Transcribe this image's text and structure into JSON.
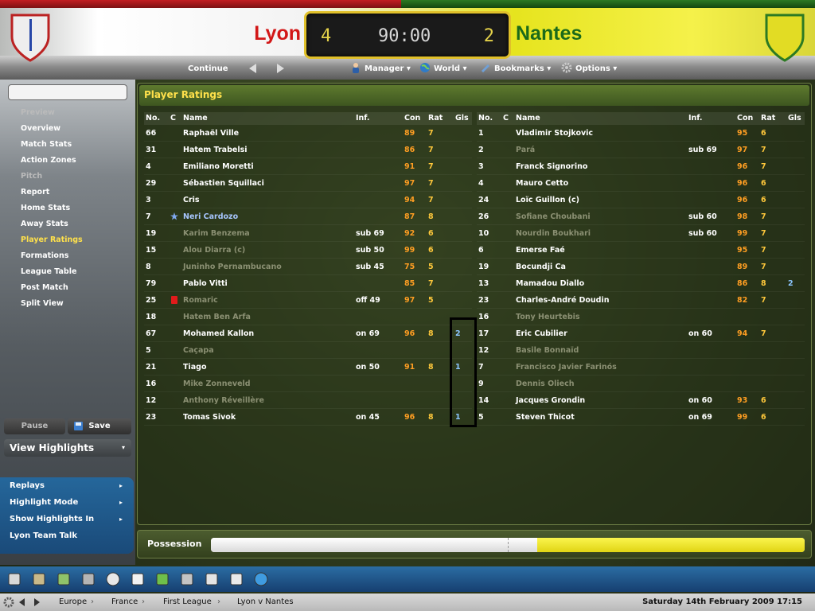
{
  "match": {
    "home_team": "Lyon",
    "away_team": "Nantes",
    "home_score": "4",
    "away_score": "2",
    "clock": "90:00",
    "home_color": "#d21717",
    "away_color": "#1b6a1a"
  },
  "toolbar": {
    "continue_label": "Continue",
    "manager_label": "Manager",
    "world_label": "World",
    "bookmarks_label": "Bookmarks",
    "options_label": "Options"
  },
  "sidebar": {
    "search_placeholder": "",
    "items": [
      {
        "label": "Preview",
        "kind": "section"
      },
      {
        "label": "Overview",
        "kind": "link"
      },
      {
        "label": "Match Stats",
        "kind": "link"
      },
      {
        "label": "Action Zones",
        "kind": "link"
      },
      {
        "label": "Pitch",
        "kind": "section"
      },
      {
        "label": "Report",
        "kind": "link"
      },
      {
        "label": "Home Stats",
        "kind": "link"
      },
      {
        "label": "Away Stats",
        "kind": "link"
      },
      {
        "label": "Player Ratings",
        "kind": "active"
      },
      {
        "label": "Formations",
        "kind": "link"
      },
      {
        "label": "League Table",
        "kind": "link"
      },
      {
        "label": "Post Match",
        "kind": "link"
      },
      {
        "label": "Split View",
        "kind": "link"
      }
    ],
    "pause_label": "Pause",
    "save_label": "Save",
    "view_highlights_label": "View Highlights",
    "highlight_items": [
      "Replays",
      "Highlight Mode",
      "Show Highlights In",
      "Lyon Team Talk"
    ]
  },
  "ratings": {
    "title": "Player Ratings",
    "headers": {
      "no": "No.",
      "c": "C",
      "name": "Name",
      "inf": "Inf.",
      "con": "Con",
      "rat": "Rat",
      "gls": "Gls"
    },
    "home": [
      {
        "no": "66",
        "name": "Raphaël Ville",
        "inf": "",
        "con": "89",
        "rat": "7",
        "gls": "",
        "dim": false,
        "icon": ""
      },
      {
        "no": "31",
        "name": "Hatem Trabelsi",
        "inf": "",
        "con": "86",
        "rat": "7",
        "gls": "",
        "dim": false,
        "icon": ""
      },
      {
        "no": "4",
        "name": "Emiliano Moretti",
        "inf": "",
        "con": "91",
        "rat": "7",
        "gls": "",
        "dim": false,
        "icon": ""
      },
      {
        "no": "29",
        "name": "Sébastien Squillaci",
        "inf": "",
        "con": "97",
        "rat": "7",
        "gls": "",
        "dim": false,
        "icon": ""
      },
      {
        "no": "3",
        "name": "Cris",
        "inf": "",
        "con": "94",
        "rat": "7",
        "gls": "",
        "dim": false,
        "icon": ""
      },
      {
        "no": "7",
        "name": "Neri Cardozo",
        "inf": "",
        "con": "87",
        "rat": "8",
        "gls": "",
        "dim": false,
        "icon": "star-icon"
      },
      {
        "no": "19",
        "name": "Karim Benzema",
        "inf": "sub 69",
        "con": "92",
        "rat": "6",
        "gls": "",
        "dim": true,
        "icon": ""
      },
      {
        "no": "15",
        "name": "Alou Diarra (c)",
        "inf": "sub 50",
        "con": "99",
        "rat": "6",
        "gls": "",
        "dim": true,
        "icon": ""
      },
      {
        "no": "8",
        "name": "Juninho Pernambucano",
        "inf": "sub 45",
        "con": "75",
        "rat": "5",
        "gls": "",
        "dim": true,
        "icon": ""
      },
      {
        "no": "79",
        "name": "Pablo Vitti",
        "inf": "",
        "con": "85",
        "rat": "7",
        "gls": "",
        "dim": false,
        "icon": ""
      },
      {
        "no": "25",
        "name": "Romaric",
        "inf": "off 49",
        "con": "97",
        "rat": "5",
        "gls": "",
        "dim": true,
        "icon": "red-card-icon"
      },
      {
        "no": "18",
        "name": "Hatem Ben Arfa",
        "inf": "",
        "con": "",
        "rat": "",
        "gls": "",
        "dim": true,
        "icon": ""
      },
      {
        "no": "67",
        "name": "Mohamed Kallon",
        "inf": "on 69",
        "con": "96",
        "rat": "8",
        "gls": "2",
        "dim": false,
        "icon": ""
      },
      {
        "no": "5",
        "name": "Caçapa",
        "inf": "",
        "con": "",
        "rat": "",
        "gls": "",
        "dim": true,
        "icon": ""
      },
      {
        "no": "21",
        "name": "Tiago",
        "inf": "on 50",
        "con": "91",
        "rat": "8",
        "gls": "1",
        "dim": false,
        "icon": ""
      },
      {
        "no": "16",
        "name": "Mike Zonneveld",
        "inf": "",
        "con": "",
        "rat": "",
        "gls": "",
        "dim": true,
        "icon": ""
      },
      {
        "no": "12",
        "name": "Anthony Réveillère",
        "inf": "",
        "con": "",
        "rat": "",
        "gls": "",
        "dim": true,
        "icon": ""
      },
      {
        "no": "23",
        "name": "Tomas Sivok",
        "inf": "on 45",
        "con": "96",
        "rat": "8",
        "gls": "1",
        "dim": false,
        "icon": ""
      }
    ],
    "away": [
      {
        "no": "1",
        "name": "Vladimir Stojkovic",
        "inf": "",
        "con": "95",
        "rat": "6",
        "gls": "",
        "dim": false,
        "icon": ""
      },
      {
        "no": "2",
        "name": "Pará",
        "inf": "sub 69",
        "con": "97",
        "rat": "7",
        "gls": "",
        "dim": true,
        "icon": ""
      },
      {
        "no": "3",
        "name": "Franck Signorino",
        "inf": "",
        "con": "96",
        "rat": "7",
        "gls": "",
        "dim": false,
        "icon": ""
      },
      {
        "no": "4",
        "name": "Mauro Cetto",
        "inf": "",
        "con": "96",
        "rat": "6",
        "gls": "",
        "dim": false,
        "icon": ""
      },
      {
        "no": "24",
        "name": "Loïc Guillon (c)",
        "inf": "",
        "con": "96",
        "rat": "6",
        "gls": "",
        "dim": false,
        "icon": ""
      },
      {
        "no": "26",
        "name": "Sofiane Choubani",
        "inf": "sub 60",
        "con": "98",
        "rat": "7",
        "gls": "",
        "dim": true,
        "icon": ""
      },
      {
        "no": "10",
        "name": "Nourdin Boukhari",
        "inf": "sub 60",
        "con": "99",
        "rat": "7",
        "gls": "",
        "dim": true,
        "icon": ""
      },
      {
        "no": "6",
        "name": "Emerse Faé",
        "inf": "",
        "con": "95",
        "rat": "7",
        "gls": "",
        "dim": false,
        "icon": ""
      },
      {
        "no": "19",
        "name": "Bocundji Ca",
        "inf": "",
        "con": "89",
        "rat": "7",
        "gls": "",
        "dim": false,
        "icon": ""
      },
      {
        "no": "13",
        "name": "Mamadou Diallo",
        "inf": "",
        "con": "86",
        "rat": "8",
        "gls": "2",
        "dim": false,
        "icon": ""
      },
      {
        "no": "23",
        "name": "Charles-André Doudin",
        "inf": "",
        "con": "82",
        "rat": "7",
        "gls": "",
        "dim": false,
        "icon": ""
      },
      {
        "no": "16",
        "name": "Tony Heurtebis",
        "inf": "",
        "con": "",
        "rat": "",
        "gls": "",
        "dim": true,
        "icon": ""
      },
      {
        "no": "17",
        "name": "Eric Cubilier",
        "inf": "on 60",
        "con": "94",
        "rat": "7",
        "gls": "",
        "dim": false,
        "icon": ""
      },
      {
        "no": "12",
        "name": "Basile Bonnaïd",
        "inf": "",
        "con": "",
        "rat": "",
        "gls": "",
        "dim": true,
        "icon": ""
      },
      {
        "no": "7",
        "name": "Francisco Javier Farinós",
        "inf": "",
        "con": "",
        "rat": "",
        "gls": "",
        "dim": true,
        "icon": ""
      },
      {
        "no": "9",
        "name": "Dennis Oliech",
        "inf": "",
        "con": "",
        "rat": "",
        "gls": "",
        "dim": true,
        "icon": ""
      },
      {
        "no": "14",
        "name": "Jacques Grondin",
        "inf": "on 60",
        "con": "93",
        "rat": "6",
        "gls": "",
        "dim": false,
        "icon": ""
      },
      {
        "no": "5",
        "name": "Steven Thicot",
        "inf": "on 69",
        "con": "99",
        "rat": "6",
        "gls": "",
        "dim": false,
        "icon": ""
      }
    ]
  },
  "possession": {
    "label": "Possession",
    "home_fraction": 0.55,
    "away_fraction": 0.45
  },
  "bottom_bar": {
    "icons": [
      "home-icon",
      "news-icon",
      "squad-icon",
      "competitions-icon",
      "trophy-icon",
      "inbox-icon",
      "tactics-icon",
      "scouting-icon",
      "schedule-icon",
      "finances-icon",
      "world-icon"
    ]
  },
  "breadcrumbs": {
    "items": [
      "Europe",
      "France",
      "First League",
      "Lyon v Nantes"
    ],
    "datetime": "Saturday 14th February 2009 17:15"
  }
}
